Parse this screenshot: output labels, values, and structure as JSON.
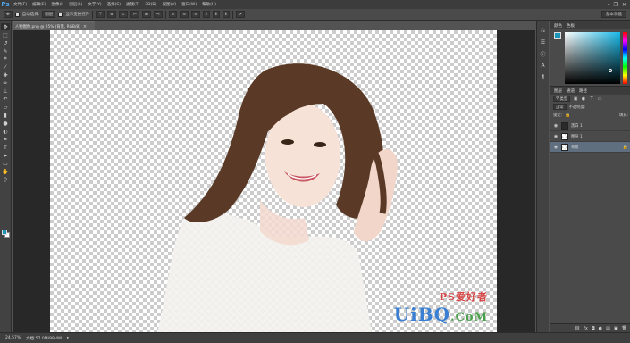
{
  "app": {
    "logo": "Ps"
  },
  "menu": [
    "文件(F)",
    "编辑(E)",
    "图像(I)",
    "图层(L)",
    "文字(Y)",
    "选择(S)",
    "滤镜(T)",
    "3D(D)",
    "视图(V)",
    "窗口(W)",
    "帮助(H)"
  ],
  "window_controls": {
    "minimize": "–",
    "restore": "❐",
    "close": "✕"
  },
  "options": {
    "auto_select_label": "自动选择:",
    "auto_select_value": "图层",
    "show_transform_label": "显示变换控件",
    "workspace": "基本功能"
  },
  "document": {
    "tab_title": "人物图像.png @ 25% (背景, RGB/8)",
    "tab_close": "×"
  },
  "status": {
    "zoom": "24.57%",
    "doc_info": "文档:57.0M/99.4M"
  },
  "watermark": {
    "part1": "UiBQ",
    "part2": ".CoM",
    "logo_text": "PS爱好者"
  },
  "colors": {
    "foreground": "#1c96b8",
    "background": "#ffffff",
    "accent": "#4fa3e8"
  },
  "color_panel": {
    "tabs": [
      "颜色",
      "色板"
    ]
  },
  "layers_panel": {
    "tabs": [
      "图层",
      "通道",
      "路径"
    ],
    "filter_label": "类型",
    "blend_mode": "正常",
    "opacity_label": "不透明度:",
    "lock_label": "锁定:",
    "fill_label": "填充:",
    "layers": [
      {
        "name": "黑白 1",
        "type": "adjustment",
        "visible": true,
        "selected": false
      },
      {
        "name": "图层 1",
        "type": "pixel",
        "visible": true,
        "selected": false
      },
      {
        "name": "背景",
        "type": "background",
        "visible": true,
        "selected": true
      }
    ]
  },
  "icons": {
    "tools": [
      "move-icon",
      "marquee-icon",
      "lasso-icon",
      "quick-select-icon",
      "crop-icon",
      "eyedropper-icon",
      "healing-icon",
      "brush-icon",
      "stamp-icon",
      "history-brush-icon",
      "eraser-icon",
      "gradient-icon",
      "blur-icon",
      "dodge-icon",
      "pen-icon",
      "type-icon",
      "path-select-icon",
      "shape-icon",
      "hand-icon",
      "zoom-icon"
    ]
  }
}
